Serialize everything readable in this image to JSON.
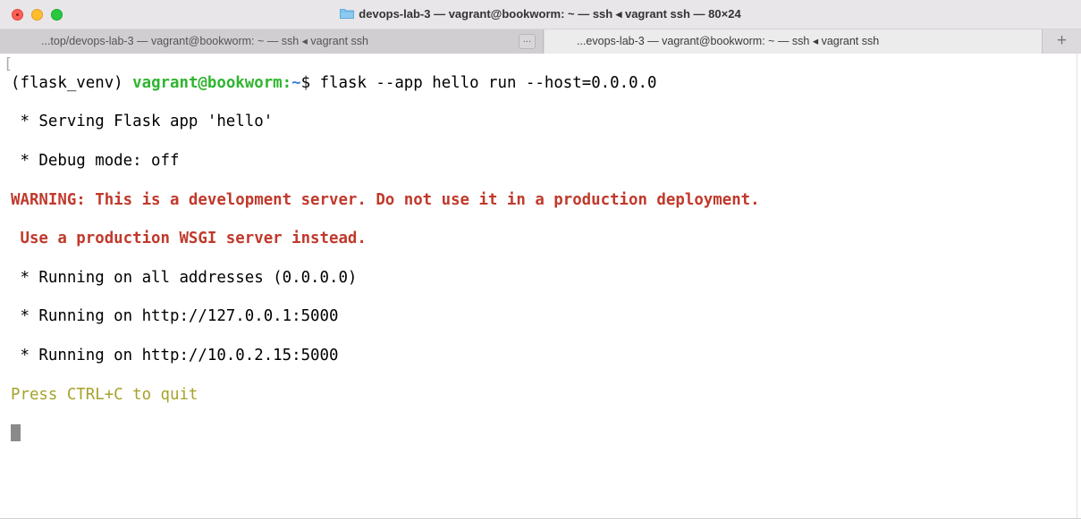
{
  "window": {
    "title": "devops-lab-3 — vagrant@bookworm: ~ — ssh ◂ vagrant ssh — 80×24"
  },
  "tabs": [
    {
      "label": "...top/devops-lab-3 — vagrant@bookworm: ~ — ssh ◂ vagrant ssh",
      "more": "..."
    },
    {
      "label": "...evops-lab-3 — vagrant@bookworm: ~ — ssh ◂ vagrant ssh"
    }
  ],
  "new_tab_label": "+",
  "terminal": {
    "prompt_env": "(flask_venv) ",
    "prompt_user": "vagrant@bookworm",
    "prompt_colon": ":",
    "prompt_path": "~",
    "prompt_symbol": "$ ",
    "command": "flask --app hello run --host=0.0.0.0",
    "output": [
      " * Serving Flask app 'hello'",
      " * Debug mode: off"
    ],
    "warning": [
      "WARNING: This is a development server. Do not use it in a production deployment.",
      " Use a production WSGI server instead."
    ],
    "running": [
      " * Running on all addresses (0.0.0.0)",
      " * Running on http://127.0.0.1:5000",
      " * Running on http://10.0.2.15:5000"
    ],
    "quit_hint": "Press CTRL+C to quit"
  },
  "colors": {
    "prompt_user": "#2fb52f",
    "prompt_path": "#3b7fd8",
    "warning": "#c0392b",
    "quit_hint": "#a6a22a"
  },
  "icons": [
    "folder-icon",
    "close-window-icon",
    "minimize-window-icon",
    "maximize-window-icon",
    "new-tab-icon"
  ]
}
